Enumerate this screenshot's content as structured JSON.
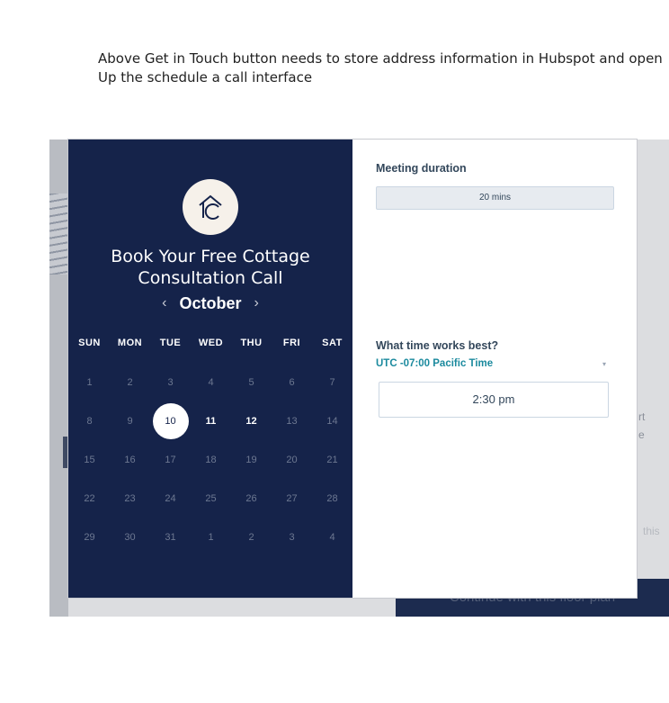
{
  "note": {
    "line1": "Above Get in Touch button needs to store address information in Hubspot and open",
    "line2": "Up the schedule a call interface"
  },
  "background": {
    "partial_text_1": "rt",
    "partial_text_2": "e",
    "partial_text_3": "this",
    "continue_button": "Continue with this floor plan"
  },
  "calendar": {
    "logo_icon": "cottage-house-icon",
    "title_line1": "Book Your Free Cottage",
    "title_line2": "Consultation Call",
    "month": "October",
    "prev_arrow": "‹",
    "next_arrow": "›",
    "weekdays": [
      "SUN",
      "MON",
      "TUE",
      "WED",
      "THU",
      "FRI",
      "SAT"
    ],
    "weeks": [
      [
        {
          "d": "1",
          "s": "disabled"
        },
        {
          "d": "2",
          "s": "disabled"
        },
        {
          "d": "3",
          "s": "disabled"
        },
        {
          "d": "4",
          "s": "disabled"
        },
        {
          "d": "5",
          "s": "disabled"
        },
        {
          "d": "6",
          "s": "disabled"
        },
        {
          "d": "7",
          "s": "disabled"
        }
      ],
      [
        {
          "d": "8",
          "s": "disabled"
        },
        {
          "d": "9",
          "s": "disabled"
        },
        {
          "d": "10",
          "s": "selected"
        },
        {
          "d": "11",
          "s": "available"
        },
        {
          "d": "12",
          "s": "available"
        },
        {
          "d": "13",
          "s": "disabled"
        },
        {
          "d": "14",
          "s": "disabled"
        }
      ],
      [
        {
          "d": "15",
          "s": "disabled"
        },
        {
          "d": "16",
          "s": "disabled"
        },
        {
          "d": "17",
          "s": "disabled"
        },
        {
          "d": "18",
          "s": "disabled"
        },
        {
          "d": "19",
          "s": "disabled"
        },
        {
          "d": "20",
          "s": "disabled"
        },
        {
          "d": "21",
          "s": "disabled"
        }
      ],
      [
        {
          "d": "22",
          "s": "disabled"
        },
        {
          "d": "23",
          "s": "disabled"
        },
        {
          "d": "24",
          "s": "disabled"
        },
        {
          "d": "25",
          "s": "disabled"
        },
        {
          "d": "26",
          "s": "disabled"
        },
        {
          "d": "27",
          "s": "disabled"
        },
        {
          "d": "28",
          "s": "disabled"
        }
      ],
      [
        {
          "d": "29",
          "s": "disabled"
        },
        {
          "d": "30",
          "s": "disabled"
        },
        {
          "d": "31",
          "s": "disabled"
        },
        {
          "d": "1",
          "s": "disabled"
        },
        {
          "d": "2",
          "s": "disabled"
        },
        {
          "d": "3",
          "s": "disabled"
        },
        {
          "d": "4",
          "s": "disabled"
        }
      ]
    ]
  },
  "booking": {
    "duration_label": "Meeting duration",
    "duration_value": "20 mins",
    "time_label": "What time works best?",
    "timezone": "UTC -07:00 Pacific Time",
    "timezone_caret": "▾",
    "time_slots": [
      "2:30 pm"
    ]
  },
  "colors": {
    "panel_navy": "#15234a",
    "teal_accent": "#1b8a9e",
    "text_dark": "#33475b"
  }
}
